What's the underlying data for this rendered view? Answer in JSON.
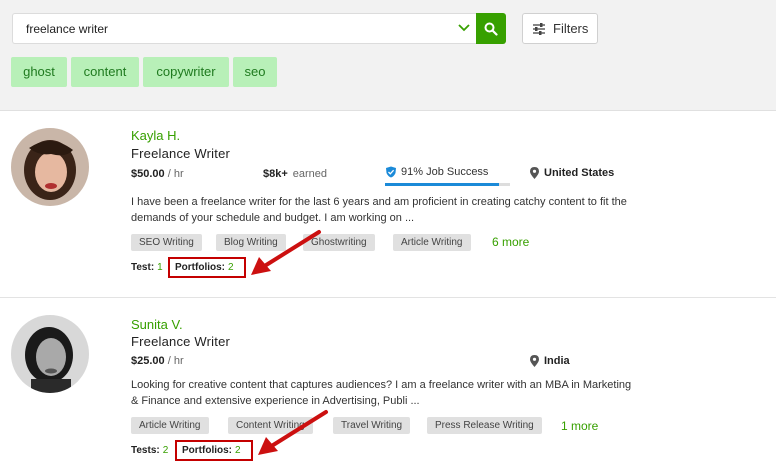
{
  "search": {
    "value": "freelance writer"
  },
  "filters_label": "Filters",
  "tags": [
    "ghost",
    "content",
    "copywriter",
    "seo"
  ],
  "freelancers": [
    {
      "name": "Kayla H.",
      "title": "Freelance Writer",
      "rate": "$50.00",
      "rate_unit": "/ hr",
      "earned": "$8k+",
      "earned_label": "earned",
      "job_success": "91% Job Success",
      "job_success_fraction": 0.91,
      "location": "United States",
      "description": "I have been a freelance writer for the last 6 years and am proficient in creating catchy content to fit the demands of your schedule and budget. I am working on ...",
      "skills": [
        "SEO Writing",
        "Blog Writing",
        "Ghostwriting",
        "Article Writing"
      ],
      "more": "6 more",
      "tests_label": "Test:",
      "tests": "1",
      "portfolios_label": "Portfolios:",
      "portfolios": "2"
    },
    {
      "name": "Sunita V.",
      "title": "Freelance Writer",
      "rate": "$25.00",
      "rate_unit": "/ hr",
      "location": "India",
      "description": "Looking for creative content that captures audiences? I am a freelance writer with an MBA in Marketing & Finance and extensive experience in Advertising, Publi ...",
      "skills": [
        "Article Writing",
        "Content Writing",
        "Travel Writing",
        "Press Release Writing"
      ],
      "more": "1 more",
      "tests_label": "Tests:",
      "tests": "2",
      "portfolios_label": "Portfolios:",
      "portfolios": "2"
    }
  ],
  "colors": {
    "brand_green": "#37a000",
    "tag_bg": "#b8f0b8",
    "highlight_red": "#c40000",
    "job_success_blue": "#1b8ad8"
  }
}
